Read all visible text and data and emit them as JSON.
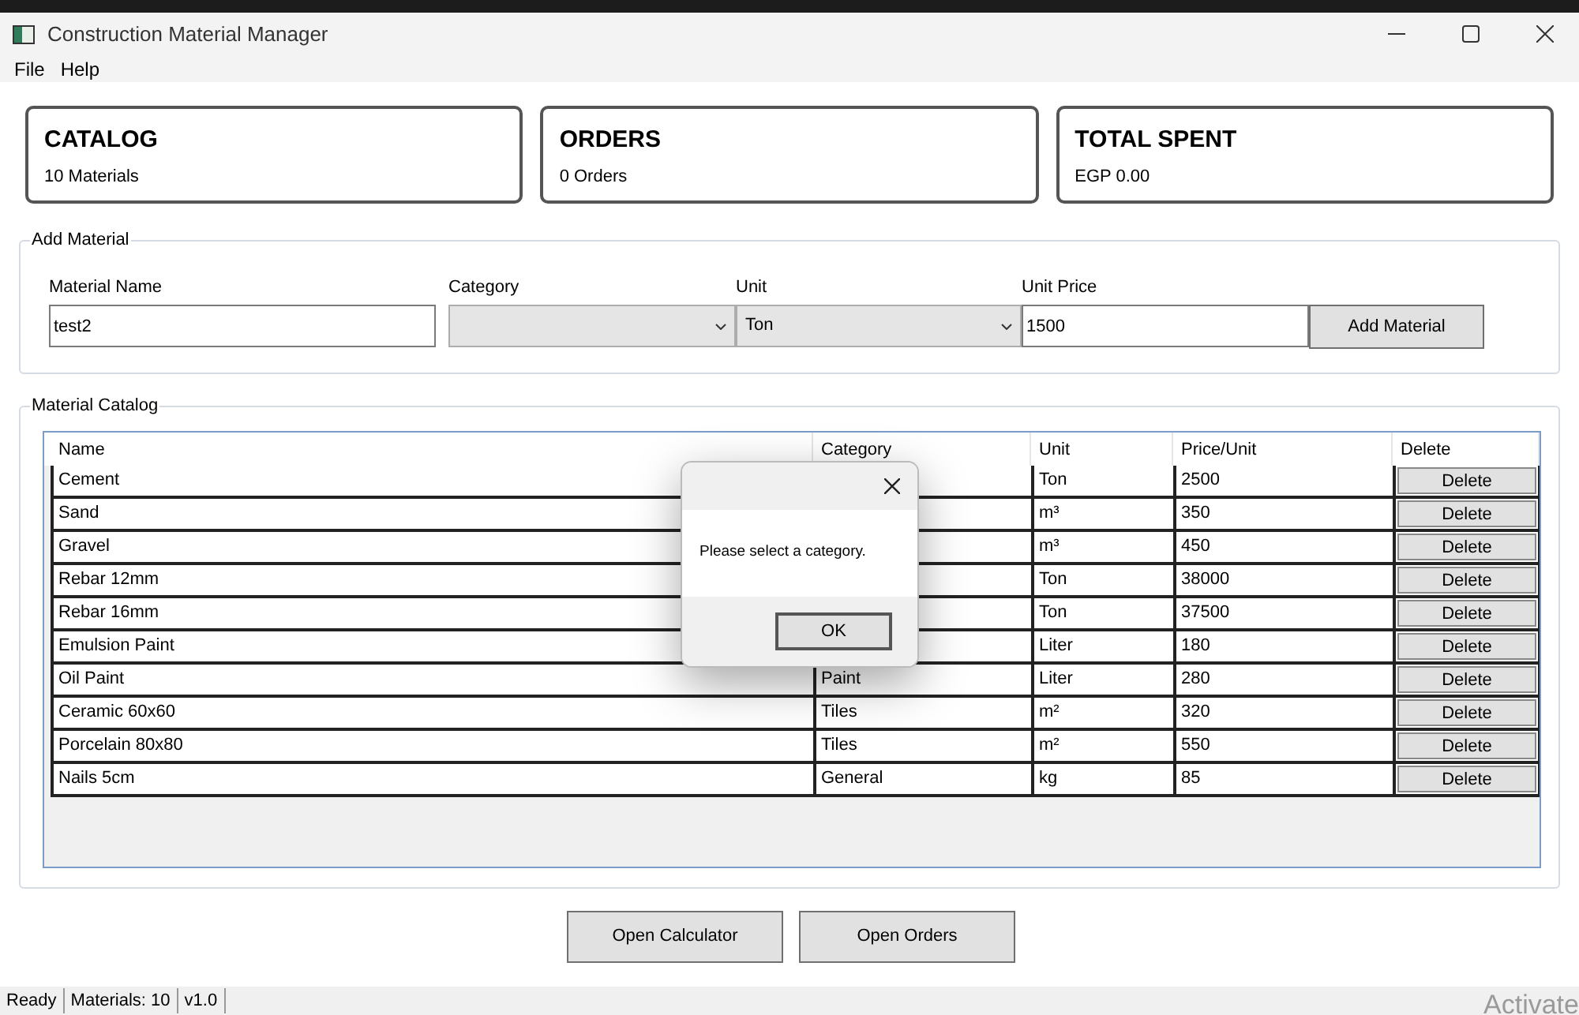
{
  "window": {
    "title": "Construction Material Manager"
  },
  "menu": [
    "File",
    "Help"
  ],
  "cards": [
    {
      "title": "CATALOG",
      "value": "10 Materials"
    },
    {
      "title": "ORDERS",
      "value": "0 Orders"
    },
    {
      "title": "TOTAL SPENT",
      "value": "EGP 0.00"
    }
  ],
  "add_material": {
    "title": "Add Material",
    "fields": [
      {
        "kind": "text",
        "label": "Material Name",
        "value": "test2"
      },
      {
        "kind": "dropdown",
        "label": "Category"
      },
      {
        "kind": "dropdown",
        "label": "Unit",
        "value": "Ton"
      },
      {
        "kind": "text",
        "label": "Unit Price",
        "value": "1500"
      }
    ],
    "button": "Add Material"
  },
  "catalog": {
    "title": "Material Catalog",
    "columns": [
      "Name",
      "Category",
      "Unit",
      "Price/Unit",
      "Delete"
    ],
    "rows": [
      {
        "name": "Cement",
        "unit": "Ton",
        "price": "2500",
        "action": "Delete"
      },
      {
        "name": "Sand",
        "unit": "m³",
        "price": "350",
        "action": "Delete"
      },
      {
        "name": "Gravel",
        "unit": "m³",
        "price": "450",
        "action": "Delete"
      },
      {
        "name": "Rebar 12mm",
        "unit": "Ton",
        "price": "38000",
        "action": "Delete"
      },
      {
        "name": "Rebar 16mm",
        "unit": "Ton",
        "price": "37500",
        "action": "Delete"
      },
      {
        "name": "Emulsion Paint",
        "unit": "Liter",
        "price": "180",
        "action": "Delete"
      },
      {
        "name": "Oil Paint",
        "category": "Paint",
        "unit": "Liter",
        "price": "280",
        "action": "Delete"
      },
      {
        "name": "Ceramic 60x60",
        "category": "Tiles",
        "unit": "m²",
        "price": "320",
        "action": "Delete"
      },
      {
        "name": "Porcelain 80x80",
        "category": "Tiles",
        "unit": "m²",
        "price": "550",
        "action": "Delete"
      },
      {
        "name": "Nails 5cm",
        "category": "General",
        "unit": "kg",
        "price": "85",
        "action": "Delete"
      }
    ]
  },
  "bottom_buttons": [
    "Open Calculator",
    "Open Orders"
  ],
  "status_bar": [
    "Ready",
    "Materials: 10",
    "v1.0"
  ],
  "activation_text": "Activate",
  "dialog": {
    "message": "Please select a category.",
    "button": "OK"
  }
}
